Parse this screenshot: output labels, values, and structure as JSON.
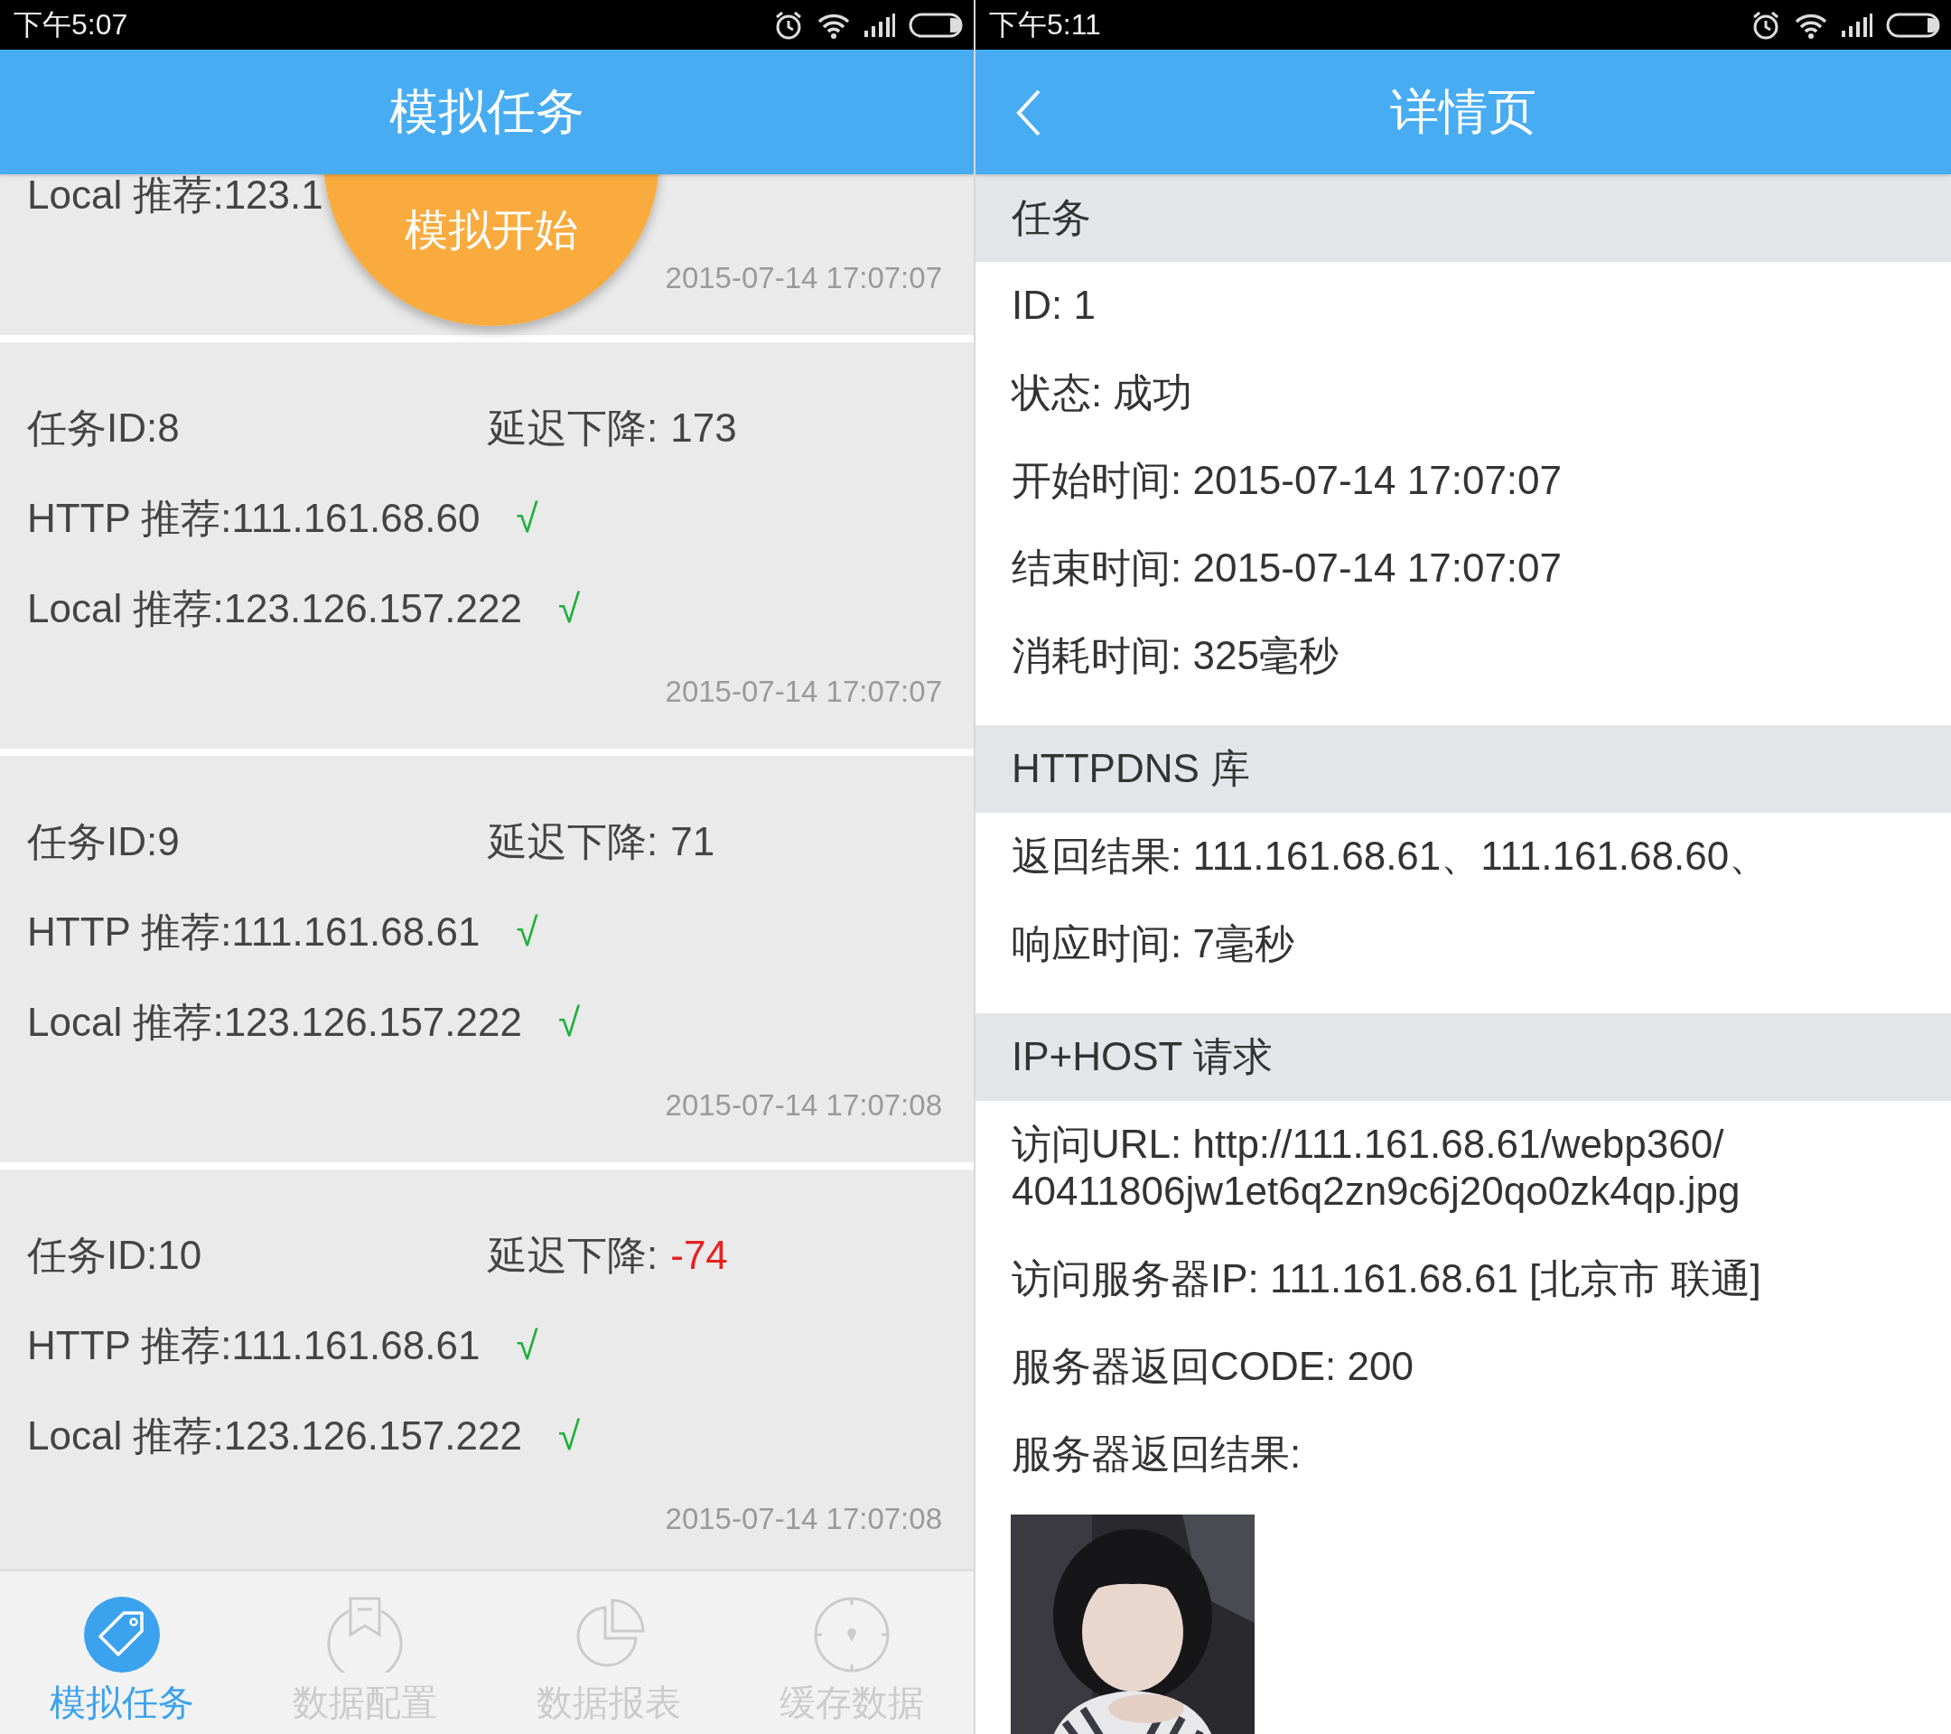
{
  "left": {
    "status_bar": {
      "time": "下午5:07"
    },
    "header": {
      "title": "模拟任务"
    },
    "tasks": [
      {
        "local": {
          "text": "Local 推荐:123.1"
        },
        "time": "2015-07-14 17:07:07"
      },
      {
        "id": "任务ID:8",
        "delay_label": "延迟下降:",
        "delay": "173",
        "color": "#444444",
        "http": {
          "text": "HTTP 推荐:111.161.68.60",
          "mark": "√"
        },
        "local": {
          "text": "Local 推荐:123.126.157.222",
          "mark": "√"
        },
        "time": "2015-07-14 17:07:07"
      },
      {
        "id": "任务ID:9",
        "delay_label": "延迟下降:",
        "delay": "71",
        "color": "#444444",
        "http": {
          "text": "HTTP 推荐:111.161.68.61",
          "mark": "√"
        },
        "local": {
          "text": "Local 推荐:123.126.157.222",
          "mark": "√"
        },
        "time": "2015-07-14 17:07:08"
      },
      {
        "id": "任务ID:10",
        "delay_label": "延迟下降:",
        "delay": "-74",
        "color": "#e82020",
        "http": {
          "text": "HTTP 推荐:111.161.68.61",
          "mark": "√"
        },
        "local": {
          "text": "Local 推荐:123.126.157.222",
          "mark": "√"
        },
        "time": "2015-07-14 17:07:08"
      }
    ],
    "fab": {
      "label": "模拟开始"
    },
    "tabs": [
      {
        "kind": "tag",
        "label": "模拟任务",
        "selected": true
      },
      {
        "kind": "bookmark",
        "label": "数据配置",
        "selected": false
      },
      {
        "kind": "pie",
        "label": "数据报表",
        "selected": false
      },
      {
        "kind": "compass",
        "label": "缓存数据",
        "selected": false
      }
    ]
  },
  "right": {
    "status_bar": {
      "time": "下午5:11"
    },
    "header": {
      "title": "详情页"
    },
    "sections": [
      {
        "title": "任务",
        "rows": [
          "ID: 1",
          "状态: 成功",
          "开始时间: 2015-07-14 17:07:07",
          "结束时间: 2015-07-14 17:07:07",
          "消耗时间: 325毫秒"
        ]
      },
      {
        "title": "HTTPDNS 库",
        "rows": [
          "返回结果: 111.161.68.61、111.161.68.60、",
          "响应时间: 7毫秒"
        ]
      },
      {
        "title": "IP+HOST 请求",
        "rows": [
          "访问URL: http://111.161.68.61/webp360/40411806jw1et6q2zn9c6j20qo0zk4qp.jpg",
          "访问服务器IP: 111.161.68.61 [北京市 联通]",
          "服务器返回CODE: 200",
          "服务器返回结果:"
        ]
      }
    ]
  }
}
